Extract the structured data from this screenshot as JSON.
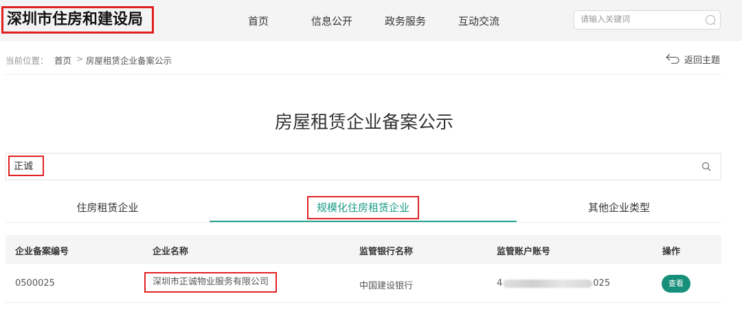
{
  "header": {
    "logo_text": "深圳市住房和建设局",
    "nav": [
      "首页",
      "信息公开",
      "政务服务",
      "互动交流"
    ],
    "search_placeholder": "请输入关键词"
  },
  "breadcrumb": {
    "prefix": "当前位置：",
    "home": "首页",
    "separator": ">",
    "current": "房屋租赁企业备案公示",
    "back_label": "返回主题"
  },
  "page_title": "房屋租赁企业备案公示",
  "search": {
    "value": "正诚"
  },
  "tabs": [
    {
      "label": "住房租赁企业",
      "active": false
    },
    {
      "label": "规模化住房租赁企业",
      "active": true
    },
    {
      "label": "其他企业类型",
      "active": false
    }
  ],
  "table": {
    "columns": [
      "企业备案编号",
      "企业名称",
      "监管银行名称",
      "监管账户账号",
      "操作"
    ],
    "rows": [
      {
        "id": "0500025",
        "name": "深圳市正诚物业服务有限公司",
        "bank": "中国建设银行",
        "account_prefix": "4",
        "account_suffix": "025",
        "action": "查看"
      }
    ]
  },
  "colors": {
    "accent": "#16907b",
    "highlight": "#e02020"
  }
}
